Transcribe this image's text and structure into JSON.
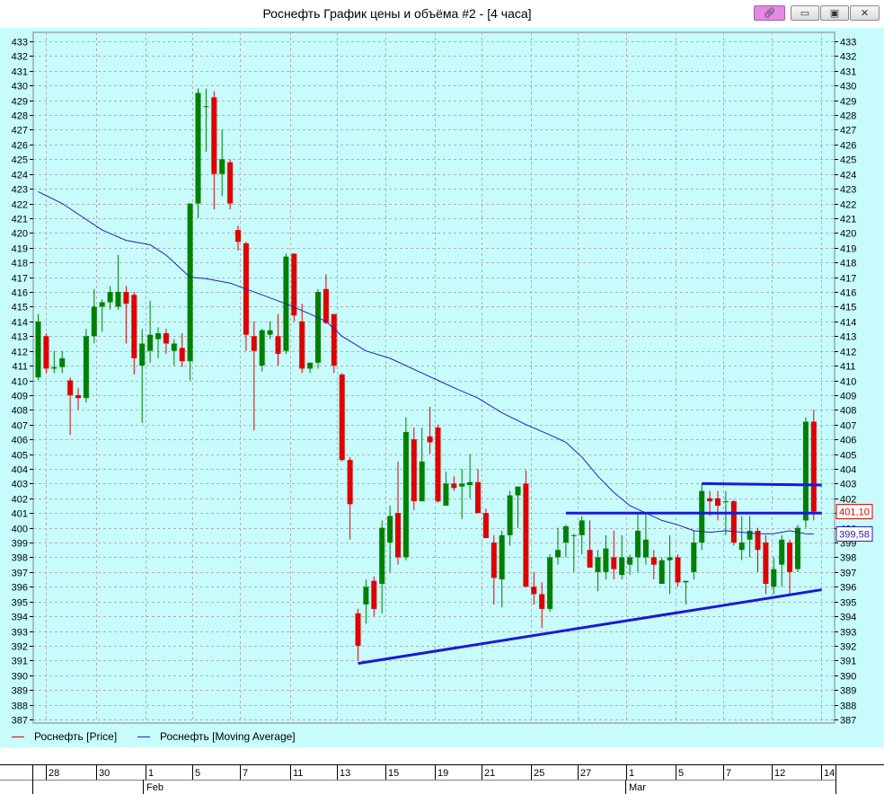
{
  "window": {
    "title": "Роснефть График цены и объёма #2 - [4 часа]",
    "pin_icon": "pin-icon",
    "min_icon": "minimize-icon",
    "max_icon": "maximize-icon",
    "close_icon": "close-icon"
  },
  "legend": {
    "price_label": "Роснефть [Price]",
    "ma_label": "Роснефть [Moving Average]"
  },
  "colors": {
    "background": "#c8fcfc",
    "grid": "#b0b0b0",
    "up": "#008000",
    "down": "#e00000",
    "ma": "#2020c0",
    "trendline": "#1a1ad8"
  },
  "chart_data": {
    "type": "candlestick",
    "ylim": [
      387,
      433
    ],
    "y_ticks_step": 1,
    "grid": true,
    "current_price": "401,10",
    "current_ma": "399,58",
    "x_axis": {
      "day_labels": [
        "28",
        "30",
        "1",
        "5",
        "7",
        "11",
        "13",
        "15",
        "19",
        "21",
        "25",
        "27",
        "1",
        "5",
        "7",
        "12",
        "14"
      ],
      "month_labels": [
        "Feb",
        "Mar"
      ]
    },
    "candles": [
      {
        "o": 410.2,
        "h": 414.5,
        "l": 410.0,
        "c": 414.0
      },
      {
        "o": 413.0,
        "h": 413.2,
        "l": 410.5,
        "c": 410.8
      },
      {
        "o": 410.8,
        "h": 412.0,
        "l": 410.5,
        "c": 410.9
      },
      {
        "o": 410.9,
        "h": 412.0,
        "l": 410.5,
        "c": 411.5
      },
      {
        "o": 410.0,
        "h": 410.2,
        "l": 406.3,
        "c": 409.0
      },
      {
        "o": 409.0,
        "h": 409.5,
        "l": 408.0,
        "c": 408.8
      },
      {
        "o": 408.8,
        "h": 413.5,
        "l": 408.5,
        "c": 413.0
      },
      {
        "o": 413.0,
        "h": 416.2,
        "l": 412.5,
        "c": 415.0
      },
      {
        "o": 415.0,
        "h": 415.5,
        "l": 413.3,
        "c": 415.3
      },
      {
        "o": 415.3,
        "h": 416.4,
        "l": 414.8,
        "c": 416.0
      },
      {
        "o": 415.0,
        "h": 418.5,
        "l": 414.8,
        "c": 416.0
      },
      {
        "o": 416.0,
        "h": 416.4,
        "l": 412.5,
        "c": 415.2
      },
      {
        "o": 415.8,
        "h": 416.0,
        "l": 410.4,
        "c": 411.5
      },
      {
        "o": 411.0,
        "h": 413.5,
        "l": 407.1,
        "c": 412.5
      },
      {
        "o": 412.0,
        "h": 415.4,
        "l": 411.2,
        "c": 413.1
      },
      {
        "o": 412.8,
        "h": 413.6,
        "l": 411.5,
        "c": 413.2
      },
      {
        "o": 413.2,
        "h": 413.5,
        "l": 411.8,
        "c": 412.5
      },
      {
        "o": 412.0,
        "h": 412.8,
        "l": 411.0,
        "c": 412.5
      },
      {
        "o": 412.2,
        "h": 413.2,
        "l": 410.9,
        "c": 411.3
      },
      {
        "o": 411.3,
        "h": 413.0,
        "l": 410.0,
        "c": 422.0
      },
      {
        "o": 422.0,
        "h": 429.8,
        "l": 421.0,
        "c": 429.5
      },
      {
        "o": 428.6,
        "h": 429.8,
        "l": 425.5,
        "c": 428.6
      },
      {
        "o": 429.2,
        "h": 429.6,
        "l": 421.6,
        "c": 424.0
      },
      {
        "o": 424.0,
        "h": 427.0,
        "l": 422.5,
        "c": 425.0
      },
      {
        "o": 424.8,
        "h": 425.0,
        "l": 421.6,
        "c": 422.0
      },
      {
        "o": 420.2,
        "h": 420.5,
        "l": 418.8,
        "c": 419.4
      },
      {
        "o": 419.3,
        "h": 419.4,
        "l": 412.0,
        "c": 413.1
      },
      {
        "o": 413.0,
        "h": 414.0,
        "l": 406.6,
        "c": 412.0
      },
      {
        "o": 411.0,
        "h": 413.5,
        "l": 410.6,
        "c": 413.4
      },
      {
        "o": 413.1,
        "h": 414.0,
        "l": 412.8,
        "c": 413.4
      },
      {
        "o": 413.0,
        "h": 414.5,
        "l": 411.0,
        "c": 411.8
      },
      {
        "o": 412.0,
        "h": 418.6,
        "l": 411.8,
        "c": 418.4
      },
      {
        "o": 418.6,
        "h": 418.6,
        "l": 414.0,
        "c": 414.4
      },
      {
        "o": 414.0,
        "h": 415.2,
        "l": 410.5,
        "c": 410.8
      },
      {
        "o": 410.8,
        "h": 411.2,
        "l": 410.5,
        "c": 411.2
      },
      {
        "o": 411.2,
        "h": 416.2,
        "l": 410.8,
        "c": 416.0
      },
      {
        "o": 416.2,
        "h": 417.2,
        "l": 413.8,
        "c": 413.9
      },
      {
        "o": 414.5,
        "h": 414.5,
        "l": 410.5,
        "c": 411.0
      },
      {
        "o": 410.4,
        "h": 410.5,
        "l": 404.5,
        "c": 404.6
      },
      {
        "o": 404.6,
        "h": 404.8,
        "l": 399.2,
        "c": 401.6
      },
      {
        "o": 394.2,
        "h": 394.5,
        "l": 391.0,
        "c": 392.0
      },
      {
        "o": 394.8,
        "h": 396.5,
        "l": 393.5,
        "c": 396.0
      },
      {
        "o": 396.4,
        "h": 396.7,
        "l": 394.0,
        "c": 394.5
      },
      {
        "o": 396.2,
        "h": 400.5,
        "l": 394.2,
        "c": 400.0
      },
      {
        "o": 399.0,
        "h": 401.5,
        "l": 397.0,
        "c": 400.8
      },
      {
        "o": 401.0,
        "h": 404.5,
        "l": 397.5,
        "c": 398.0
      },
      {
        "o": 398.0,
        "h": 407.5,
        "l": 397.8,
        "c": 406.5
      },
      {
        "o": 406.0,
        "h": 406.8,
        "l": 401.2,
        "c": 401.8
      },
      {
        "o": 401.8,
        "h": 406.8,
        "l": 401.8,
        "c": 404.5
      },
      {
        "o": 406.2,
        "h": 408.2,
        "l": 405.0,
        "c": 405.8
      },
      {
        "o": 406.8,
        "h": 407.0,
        "l": 401.7,
        "c": 401.8
      },
      {
        "o": 401.5,
        "h": 403.8,
        "l": 401.5,
        "c": 403.0
      },
      {
        "o": 403.0,
        "h": 403.5,
        "l": 402.5,
        "c": 402.7
      },
      {
        "o": 402.8,
        "h": 404.0,
        "l": 400.6,
        "c": 403.0
      },
      {
        "o": 402.9,
        "h": 405.0,
        "l": 402.0,
        "c": 403.1
      },
      {
        "o": 403.1,
        "h": 404.0,
        "l": 401.7,
        "c": 401.0
      },
      {
        "o": 401.0,
        "h": 401.3,
        "l": 399.5,
        "c": 399.3
      },
      {
        "o": 399.0,
        "h": 399.5,
        "l": 394.8,
        "c": 396.6
      },
      {
        "o": 396.5,
        "h": 399.8,
        "l": 394.6,
        "c": 399.5
      },
      {
        "o": 399.5,
        "h": 402.5,
        "l": 398.8,
        "c": 402.2
      },
      {
        "o": 402.2,
        "h": 402.5,
        "l": 400.0,
        "c": 402.8
      },
      {
        "o": 403.0,
        "h": 403.9,
        "l": 396.0,
        "c": 396.0
      },
      {
        "o": 396.0,
        "h": 397.0,
        "l": 394.8,
        "c": 395.5
      },
      {
        "o": 395.5,
        "h": 396.3,
        "l": 393.2,
        "c": 394.5
      },
      {
        "o": 394.5,
        "h": 398.2,
        "l": 394.3,
        "c": 398.0
      },
      {
        "o": 398.0,
        "h": 400.0,
        "l": 397.5,
        "c": 398.5
      },
      {
        "o": 399.0,
        "h": 400.2,
        "l": 398.0,
        "c": 400.1
      },
      {
        "o": 399.5,
        "h": 399.6,
        "l": 397.0,
        "c": 399.5
      },
      {
        "o": 399.5,
        "h": 400.8,
        "l": 398.2,
        "c": 400.5
      },
      {
        "o": 398.5,
        "h": 400.5,
        "l": 397.5,
        "c": 397.3
      },
      {
        "o": 397.0,
        "h": 398.5,
        "l": 395.7,
        "c": 398.0
      },
      {
        "o": 397.0,
        "h": 399.5,
        "l": 396.5,
        "c": 398.6
      },
      {
        "o": 398.0,
        "h": 399.8,
        "l": 396.5,
        "c": 397.2
      },
      {
        "o": 396.8,
        "h": 399.5,
        "l": 396.5,
        "c": 398.0
      },
      {
        "o": 397.5,
        "h": 398.2,
        "l": 396.8,
        "c": 398.0
      },
      {
        "o": 398.0,
        "h": 401.0,
        "l": 397.0,
        "c": 399.8
      },
      {
        "o": 398.0,
        "h": 401.0,
        "l": 397.5,
        "c": 399.2
      },
      {
        "o": 398.0,
        "h": 398.5,
        "l": 396.5,
        "c": 397.5
      },
      {
        "o": 396.2,
        "h": 398.0,
        "l": 396.5,
        "c": 397.8
      },
      {
        "o": 397.8,
        "h": 399.5,
        "l": 395.5,
        "c": 398.0
      },
      {
        "o": 398.0,
        "h": 398.2,
        "l": 396.0,
        "c": 396.3
      },
      {
        "o": 396.3,
        "h": 396.4,
        "l": 394.8,
        "c": 396.4
      },
      {
        "o": 397.0,
        "h": 399.8,
        "l": 396.5,
        "c": 399.0
      },
      {
        "o": 399.0,
        "h": 403.0,
        "l": 398.5,
        "c": 402.5
      },
      {
        "o": 402.0,
        "h": 402.5,
        "l": 400.8,
        "c": 401.8
      },
      {
        "o": 402.0,
        "h": 402.5,
        "l": 400.5,
        "c": 401.5
      },
      {
        "o": 401.8,
        "h": 402.5,
        "l": 399.5,
        "c": 401.8
      },
      {
        "o": 401.8,
        "h": 401.9,
        "l": 398.8,
        "c": 399.0
      },
      {
        "o": 398.5,
        "h": 400.8,
        "l": 397.8,
        "c": 399.0
      },
      {
        "o": 399.2,
        "h": 400.8,
        "l": 398.0,
        "c": 399.8
      },
      {
        "o": 399.8,
        "h": 400.0,
        "l": 397.0,
        "c": 398.5
      },
      {
        "o": 399.0,
        "h": 399.5,
        "l": 395.5,
        "c": 396.2
      },
      {
        "o": 396.0,
        "h": 398.0,
        "l": 395.5,
        "c": 397.2
      },
      {
        "o": 397.5,
        "h": 399.5,
        "l": 396.0,
        "c": 399.2
      },
      {
        "o": 399.0,
        "h": 399.2,
        "l": 395.5,
        "c": 397.0
      },
      {
        "o": 397.2,
        "h": 400.2,
        "l": 397.0,
        "c": 400.0
      },
      {
        "o": 400.5,
        "h": 407.5,
        "l": 400.0,
        "c": 407.2
      },
      {
        "o": 407.2,
        "h": 408.0,
        "l": 400.5,
        "c": 401.1
      }
    ],
    "moving_average": [
      [
        0,
        422.8
      ],
      [
        3,
        422.0
      ],
      [
        8,
        420.2
      ],
      [
        11,
        419.5
      ],
      [
        14,
        419.2
      ],
      [
        16,
        418.5
      ],
      [
        19,
        417.0
      ],
      [
        21,
        416.9
      ],
      [
        24,
        416.6
      ],
      [
        28,
        415.8
      ],
      [
        31,
        415.2
      ],
      [
        34,
        414.5
      ],
      [
        36,
        414.0
      ],
      [
        38,
        413.0
      ],
      [
        41,
        412.0
      ],
      [
        44,
        411.5
      ],
      [
        48,
        410.5
      ],
      [
        50,
        410.0
      ],
      [
        52,
        409.5
      ],
      [
        55,
        408.8
      ],
      [
        58,
        407.8
      ],
      [
        61,
        407.0
      ],
      [
        64,
        406.3
      ],
      [
        66,
        405.8
      ],
      [
        68,
        404.8
      ],
      [
        70,
        403.5
      ],
      [
        72,
        402.4
      ],
      [
        74,
        401.5
      ],
      [
        76,
        401.0
      ],
      [
        78,
        400.5
      ],
      [
        80,
        400.2
      ],
      [
        82,
        399.8
      ],
      [
        84,
        399.7
      ],
      [
        86,
        399.8
      ],
      [
        88,
        399.7
      ],
      [
        90,
        399.6
      ],
      [
        92,
        399.6
      ],
      [
        94,
        399.8
      ],
      [
        96,
        399.6
      ],
      [
        97,
        399.58
      ]
    ],
    "trendlines": [
      {
        "x1": 40,
        "y1": 390.8,
        "x2": 98,
        "y2": 395.8
      },
      {
        "x1": 66,
        "y1": 401.0,
        "x2": 98,
        "y2": 401.0
      },
      {
        "x1": 83,
        "y1": 403.0,
        "x2": 98,
        "y2": 402.9
      }
    ]
  }
}
